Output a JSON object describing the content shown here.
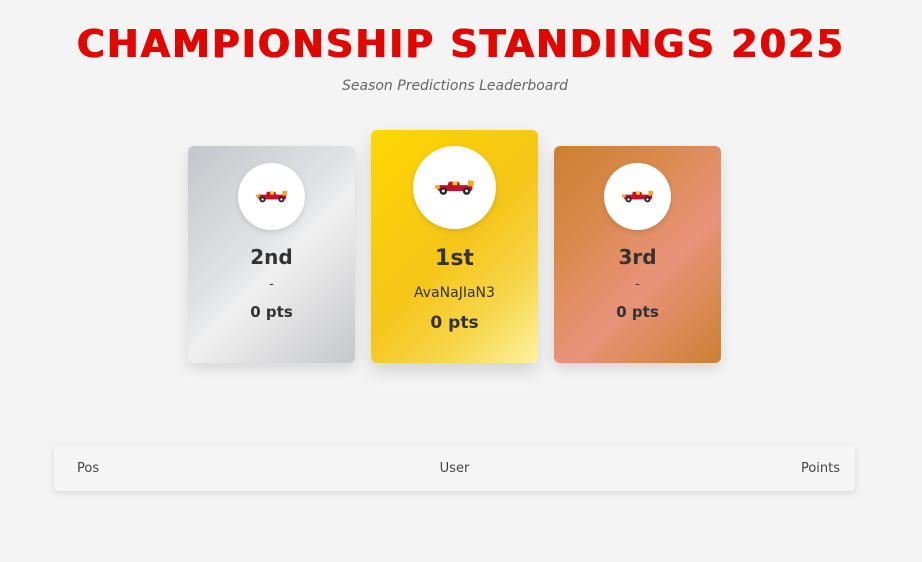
{
  "header": {
    "title": "CHAMPIONSHIP STANDINGS 2025",
    "subtitle": "Season Predictions Leaderboard"
  },
  "podium": {
    "first": {
      "place": "1st",
      "user": "AvaNaJIaN3",
      "points": "0 pts",
      "icon": "race-car-icon",
      "color": "#ffd700"
    },
    "second": {
      "place": "2nd",
      "user": "-",
      "points": "0 pts",
      "icon": "race-car-icon",
      "color": "#c0c0c0"
    },
    "third": {
      "place": "3rd",
      "user": "-",
      "points": "0 pts",
      "icon": "race-car-icon",
      "color": "#cd7f32"
    }
  },
  "table": {
    "columns": [
      "Pos",
      "User",
      "Points"
    ],
    "rows": []
  },
  "colors": {
    "accent": "#e10600",
    "background": "#f4f4f4"
  }
}
